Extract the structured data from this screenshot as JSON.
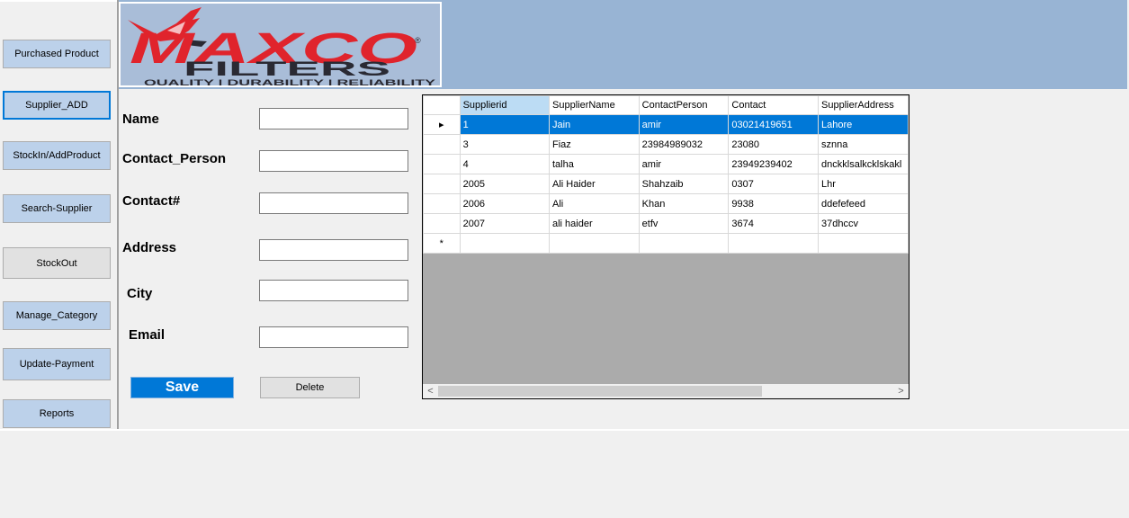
{
  "nav": {
    "purchased_product": "Purchased Product",
    "supplier_add": "Supplier_ADD",
    "stockin_addproduct": "StockIn/AddProduct",
    "search_supplier": "Search-Supplier",
    "stockout": "StockOut",
    "manage_category": "Manage_Category",
    "update_payment": "Update-Payment",
    "reports": "Reports"
  },
  "logo": {
    "brand": "MAXCO",
    "sub": "FILTERS",
    "tagline": "QUALITY | DURABILITY | RELIABILITY",
    "registered": "®"
  },
  "form": {
    "name_label": "Name",
    "contact_person_label": "Contact_Person",
    "contact_label": "Contact#",
    "address_label": "Address",
    "city_label": "City",
    "email_label": "Email",
    "name_value": "",
    "contact_person_value": "",
    "contact_value": "",
    "address_value": "",
    "city_value": "",
    "email_value": ""
  },
  "buttons": {
    "save": "Save",
    "delete": "Delete"
  },
  "grid": {
    "columns": [
      "Supplierid",
      "SupplierName",
      "ContactPerson",
      "Contact",
      "SupplierAddress"
    ],
    "rows": [
      [
        "1",
        "Jain",
        "amir",
        "03021419651",
        "Lahore"
      ],
      [
        "3",
        "Fiaz",
        "23984989032",
        "23080",
        "sznna"
      ],
      [
        "4",
        "talha",
        "amir",
        "23949239402",
        "dnckklsalkcklskakl"
      ],
      [
        "2005",
        "Ali Haider",
        "Shahzaib",
        "0307",
        "Lhr"
      ],
      [
        "2006",
        "Ali",
        "Khan",
        "9938",
        "ddefefeed"
      ],
      [
        "2007",
        "ali haider",
        "etfv",
        "3674",
        "37dhccv"
      ]
    ],
    "current_row_marker": "▸",
    "new_row_marker": "*",
    "scroll_left": "<",
    "scroll_right": ">"
  },
  "colors": {
    "header_band": "#98b4d4",
    "accent": "#0078d7",
    "logo_red": "#e0242c",
    "logo_dark": "#2a2a33"
  }
}
